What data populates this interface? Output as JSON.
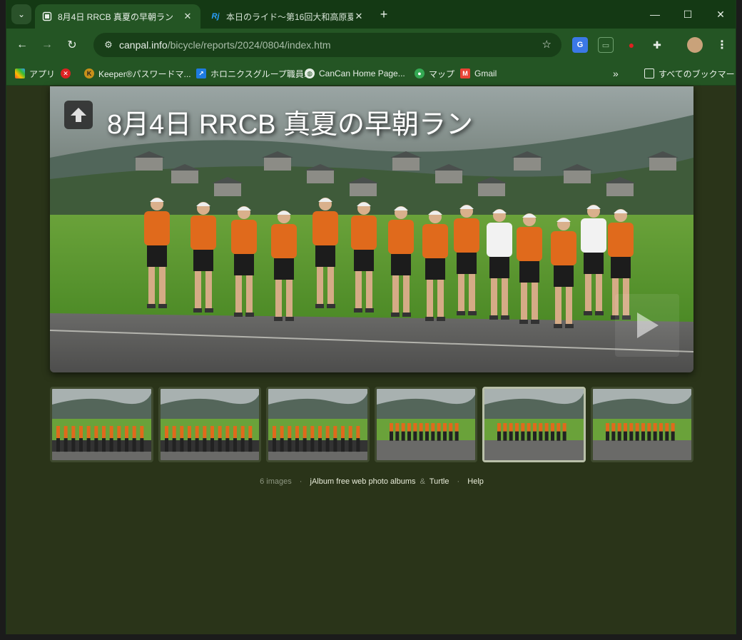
{
  "tabs": [
    {
      "title": "8月4日 RRCB 真夏の早朝ラン",
      "active": true
    },
    {
      "title": "本日のライド〜第16回大和高原夏",
      "active": false
    }
  ],
  "toolbar": {
    "url_host": "canpal.info",
    "url_path": "/bicycle/reports/2024/0804/index.htm"
  },
  "bookmarks": [
    {
      "label": "アプリ"
    },
    {
      "label": ""
    },
    {
      "label": "Keeper®パスワードマ..."
    },
    {
      "label": "ホロニクスグループ職員..."
    },
    {
      "label": "CanCan Home Page..."
    },
    {
      "label": "マップ"
    },
    {
      "label": "Gmail"
    }
  ],
  "bookmarks_all": "すべてのブックマーク",
  "album": {
    "title": "8月4日 RRCB 真夏の早朝ラン",
    "thumbnail_count": 6,
    "selected_index": 4
  },
  "footer": {
    "count": "6 images",
    "link1": "jAlbum free web photo albums",
    "amp": "&",
    "link2": "Turtle",
    "help": "Help"
  },
  "colors": {
    "chrome_bg": "#143914",
    "toolbar_bg": "#245524",
    "page_bg": "#2a3419",
    "jersey_orange": "#e06a1c"
  }
}
